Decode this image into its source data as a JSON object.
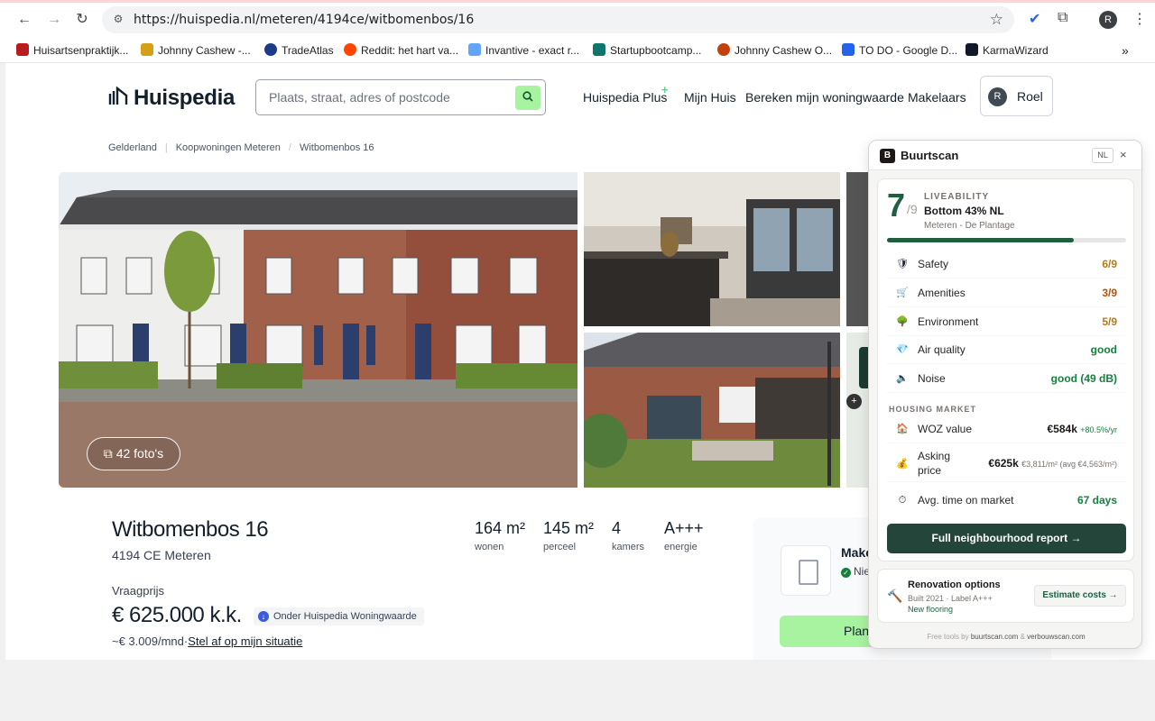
{
  "browser": {
    "url_prefix": "https://",
    "url_host": "huispedia.nl",
    "url_path": "/meteren/4194ce/witbomenbos/16",
    "profile_initial": "R",
    "bookmarks": [
      {
        "label": "Huisartsenpraktijk...",
        "color": "#b91c1c"
      },
      {
        "label": "Johnny Cashew -...",
        "color": "#d4a017"
      },
      {
        "label": "TradeAtlas",
        "color": "#1e3a8a"
      },
      {
        "label": "Reddit: het hart va...",
        "color": "#ff4500"
      },
      {
        "label": "Invantive - exact r...",
        "color": "#60a5fa"
      },
      {
        "label": "Startupbootcamp...",
        "color": "#0f766e"
      },
      {
        "label": "Johnny Cashew O...",
        "color": "#c2410c"
      },
      {
        "label": "TO DO - Google D...",
        "color": "#2563eb"
      },
      {
        "label": "KarmaWizard",
        "color": "#111827"
      }
    ]
  },
  "site": {
    "logo": "Huispedia",
    "search_placeholder": "Plaats, straat, adres of postcode",
    "nav": [
      "Huispedia Plus",
      "Mijn Huis",
      "Bereken mijn woningwaarde",
      "Makelaars"
    ],
    "user_initial": "R",
    "user_name": "Roel"
  },
  "breadcrumb": [
    "Gelderland",
    "Koopwoningen Meteren",
    "Witbomenbos 16"
  ],
  "gallery": {
    "photo_count_label": "42 foto's"
  },
  "listing": {
    "title": "Witbomenbos 16",
    "address": "4194 CE Meteren",
    "stats": [
      {
        "value": "164 m²",
        "label": "wonen"
      },
      {
        "value": "145 m²",
        "label": "perceel"
      },
      {
        "value": "4",
        "label": "kamers"
      },
      {
        "value": "A+++",
        "label": "energie"
      }
    ],
    "price_label": "Vraagprijs",
    "price": "€ 625.000 k.k.",
    "price_badge": "Onder Huispedia Woningwaarde",
    "monthly": "~€ 3.009/mnd",
    "monthly_sep": "·",
    "monthly_link": "Stel af op mijn situatie"
  },
  "agent_card": {
    "name": "Make",
    "sub": "Nie",
    "plan_button": "Plan"
  },
  "buurtscan": {
    "title": "Buurtscan",
    "lang": "NL",
    "close": "×",
    "score": "7",
    "score_den": "/9",
    "liveability_label": "LIVEABILITY",
    "rank": "Bottom 43% NL",
    "location": "Meteren - De Plantage",
    "liveability_fraction": 0.78,
    "metrics": [
      {
        "icon": "🛡",
        "label": "Safety",
        "value": "6/9",
        "color": "#b7791f"
      },
      {
        "icon": "🛒",
        "label": "Amenities",
        "value": "3/9",
        "color": "#b45309"
      },
      {
        "icon": "🌳",
        "label": "Environment",
        "value": "5/9",
        "color": "#b7791f"
      },
      {
        "icon": "💎",
        "label": "Air quality",
        "value": "good",
        "color": "#15803d"
      },
      {
        "icon": "🔈",
        "label": "Noise",
        "value": "good (49 dB)",
        "color": "#15803d"
      }
    ],
    "housing_label": "HOUSING MARKET",
    "woz_label": "WOZ value",
    "woz_value": "€584k",
    "woz_change": "+80.5%/yr",
    "asking_label_1": "Asking",
    "asking_label_2": "price",
    "asking_value": "€625k",
    "asking_detail": "€3,811/m² (avg €4,563/m²)",
    "time_label": "Avg. time on market",
    "time_value": "67 days",
    "cta": "Full neighbourhood report →",
    "reno_title": "Renovation options",
    "reno_sub": "Built 2021 · Label A+++",
    "reno_tag": "New flooring",
    "reno_button": "Estimate costs →",
    "footer_prefix": "Free tools by",
    "footer_link1": "buurtscan.com",
    "footer_amp": "&",
    "footer_link2": "verbouwscan.com"
  }
}
